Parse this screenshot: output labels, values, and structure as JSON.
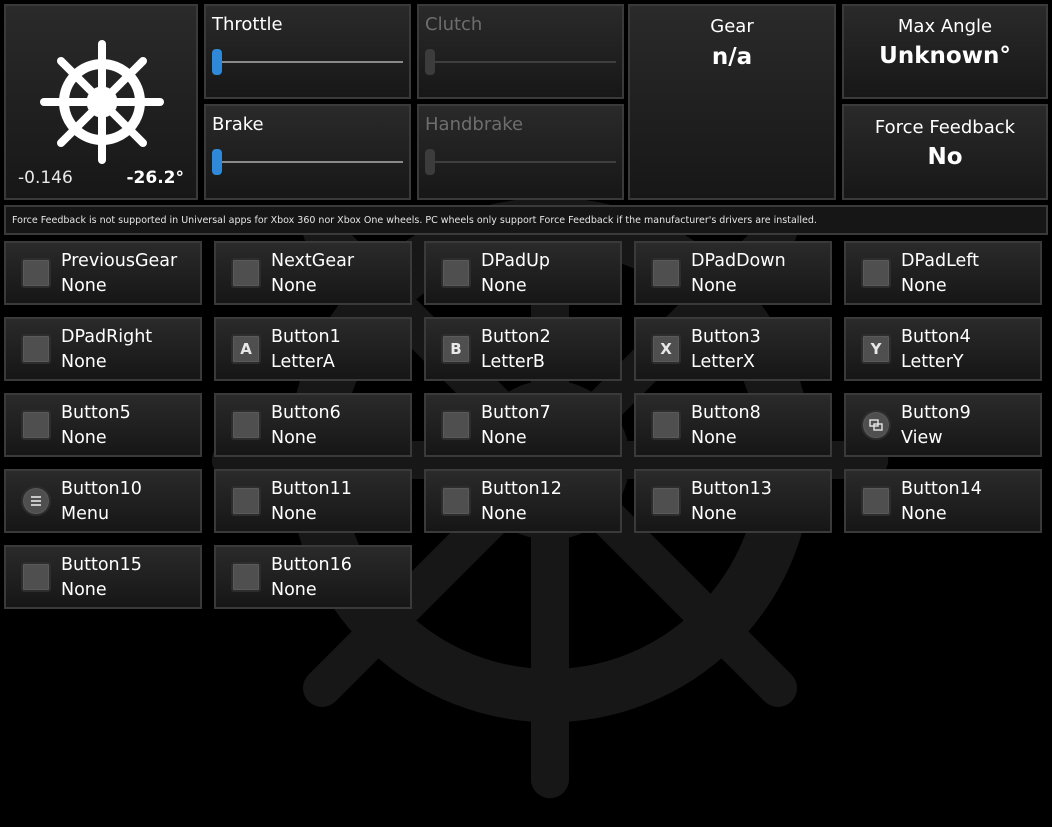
{
  "wheel": {
    "axis_value": "-0.146",
    "angle": "-26.2°",
    "icon": "ship-wheel-icon"
  },
  "sliders": [
    {
      "label": "Throttle",
      "enabled": true,
      "value": 0
    },
    {
      "label": "Clutch",
      "enabled": false,
      "value": 0
    },
    {
      "label": "Brake",
      "enabled": true,
      "value": 0
    },
    {
      "label": "Handbrake",
      "enabled": false,
      "value": 0
    }
  ],
  "gear": {
    "label": "Gear",
    "value": "n/a"
  },
  "max_angle": {
    "label": "Max Angle",
    "value": "Unknown°"
  },
  "force_feedback": {
    "label": "Force Feedback",
    "value": "No"
  },
  "message": "Force Feedback is not supported in Universal apps for Xbox 360 nor Xbox One wheels. PC wheels only support Force Feedback if the manufacturer's drivers are installed.",
  "colors": {
    "accent": "#2e8ad8",
    "background": "#000000",
    "panel": "#1e1e1e",
    "border": "#3a3a3a"
  },
  "buttons": [
    {
      "name": "PreviousGear",
      "mapping": "None",
      "glyph": "",
      "icon": "blank-square-icon"
    },
    {
      "name": "NextGear",
      "mapping": "None",
      "glyph": "",
      "icon": "blank-square-icon"
    },
    {
      "name": "DPadUp",
      "mapping": "None",
      "glyph": "",
      "icon": "blank-square-icon"
    },
    {
      "name": "DPadDown",
      "mapping": "None",
      "glyph": "",
      "icon": "blank-square-icon"
    },
    {
      "name": "DPadLeft",
      "mapping": "None",
      "glyph": "",
      "icon": "blank-square-icon"
    },
    {
      "name": "DPadRight",
      "mapping": "None",
      "glyph": "",
      "icon": "blank-square-icon"
    },
    {
      "name": "Button1",
      "mapping": "LetterA",
      "glyph": "A",
      "icon": "letter-a-icon"
    },
    {
      "name": "Button2",
      "mapping": "LetterB",
      "glyph": "B",
      "icon": "letter-b-icon"
    },
    {
      "name": "Button3",
      "mapping": "LetterX",
      "glyph": "X",
      "icon": "letter-x-icon"
    },
    {
      "name": "Button4",
      "mapping": "LetterY",
      "glyph": "Y",
      "icon": "letter-y-icon"
    },
    {
      "name": "Button5",
      "mapping": "None",
      "glyph": "",
      "icon": "blank-square-icon"
    },
    {
      "name": "Button6",
      "mapping": "None",
      "glyph": "",
      "icon": "blank-square-icon"
    },
    {
      "name": "Button7",
      "mapping": "None",
      "glyph": "",
      "icon": "blank-square-icon"
    },
    {
      "name": "Button8",
      "mapping": "None",
      "glyph": "",
      "icon": "blank-square-icon"
    },
    {
      "name": "Button9",
      "mapping": "View",
      "glyph": "",
      "icon": "view-icon"
    },
    {
      "name": "Button10",
      "mapping": "Menu",
      "glyph": "",
      "icon": "menu-icon"
    },
    {
      "name": "Button11",
      "mapping": "None",
      "glyph": "",
      "icon": "blank-square-icon"
    },
    {
      "name": "Button12",
      "mapping": "None",
      "glyph": "",
      "icon": "blank-square-icon"
    },
    {
      "name": "Button13",
      "mapping": "None",
      "glyph": "",
      "icon": "blank-square-icon"
    },
    {
      "name": "Button14",
      "mapping": "None",
      "glyph": "",
      "icon": "blank-square-icon"
    },
    {
      "name": "Button15",
      "mapping": "None",
      "glyph": "",
      "icon": "blank-square-icon"
    },
    {
      "name": "Button16",
      "mapping": "None",
      "glyph": "",
      "icon": "blank-square-icon"
    }
  ]
}
